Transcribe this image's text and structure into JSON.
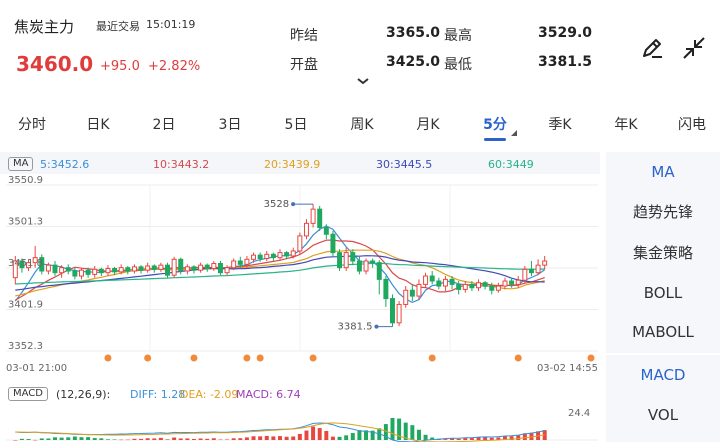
{
  "header": {
    "name": "焦炭主力",
    "recent_label": "最近交易",
    "time": "15:01:19",
    "price": "3460.0",
    "change": "+95.0",
    "change_pct": "+2.82%",
    "stats": [
      {
        "label": "昨结",
        "value": "3365.0"
      },
      {
        "label": "最高",
        "value": "3529.0"
      },
      {
        "label": "开盘",
        "value": "3425.0"
      },
      {
        "label": "最低",
        "value": "3381.5"
      }
    ]
  },
  "tabs": [
    "分时",
    "日K",
    "2日",
    "3日",
    "5日",
    "周K",
    "月K",
    "5分",
    "季K",
    "年K",
    "闪电"
  ],
  "active_tab": "5分",
  "ma": {
    "tag": "MA",
    "values": [
      {
        "text": "5:3452.6",
        "color": "#3a8fd8"
      },
      {
        "text": "10:3443.2",
        "color": "#d84a4a"
      },
      {
        "text": "20:3439.9",
        "color": "#e0a020"
      },
      {
        "text": "30:3445.5",
        "color": "#3f49b8"
      },
      {
        "text": "60:3449",
        "color": "#28b38a"
      }
    ]
  },
  "side_menu": {
    "items": [
      "MA",
      "趋势先锋",
      "集金策略",
      "BOLL",
      "MABOLL"
    ],
    "items2": [
      "MACD",
      "VOL"
    ]
  },
  "macd": {
    "tag": "MACD",
    "params": "(12,26,9):",
    "diff": "DIFF: 1.28",
    "dea": "DEA: -2.09",
    "macd": "MACD: 6.74",
    "scale_max": "24.4"
  },
  "chart_data": {
    "type": "candlestick",
    "y_labels": [
      "3550.9",
      "3501.3",
      "3451.8",
      "3401.9",
      "3352.3"
    ],
    "ylim": [
      3352.3,
      3550.9
    ],
    "high_label": "3528",
    "low_label": "3381.5",
    "x_start": "03-01 21:00",
    "x_end": "03-02 14:55",
    "candles": [
      [
        3440,
        3460,
        3432,
        3466
      ],
      [
        3460,
        3452,
        3446,
        3463
      ],
      [
        3452,
        3458,
        3448,
        3462
      ],
      [
        3458,
        3464,
        3452,
        3478
      ],
      [
        3464,
        3448,
        3444,
        3468
      ],
      [
        3448,
        3455,
        3444,
        3458
      ],
      [
        3455,
        3446,
        3442,
        3460
      ],
      [
        3446,
        3452,
        3440,
        3455
      ],
      [
        3452,
        3448,
        3444,
        3456
      ],
      [
        3448,
        3442,
        3438,
        3452
      ],
      [
        3442,
        3449,
        3438,
        3452
      ],
      [
        3449,
        3444,
        3440,
        3452
      ],
      [
        3444,
        3450,
        3440,
        3454
      ],
      [
        3450,
        3446,
        3442,
        3452
      ],
      [
        3446,
        3451,
        3442,
        3455
      ],
      [
        3451,
        3447,
        3443,
        3453
      ],
      [
        3447,
        3452,
        3444,
        3456
      ],
      [
        3452,
        3448,
        3444,
        3454
      ],
      [
        3448,
        3453,
        3445,
        3456
      ],
      [
        3453,
        3449,
        3445,
        3455
      ],
      [
        3449,
        3454,
        3446,
        3458
      ],
      [
        3454,
        3450,
        3446,
        3456
      ],
      [
        3450,
        3455,
        3447,
        3458
      ],
      [
        3455,
        3443,
        3440,
        3458
      ],
      [
        3443,
        3462,
        3440,
        3465
      ],
      [
        3462,
        3448,
        3444,
        3464
      ],
      [
        3448,
        3453,
        3444,
        3456
      ],
      [
        3453,
        3449,
        3445,
        3455
      ],
      [
        3449,
        3455,
        3446,
        3458
      ],
      [
        3455,
        3451,
        3447,
        3457
      ],
      [
        3451,
        3457,
        3448,
        3460
      ],
      [
        3457,
        3446,
        3443,
        3460
      ],
      [
        3446,
        3452,
        3443,
        3455
      ],
      [
        3452,
        3460,
        3449,
        3463
      ],
      [
        3460,
        3456,
        3452,
        3465
      ],
      [
        3456,
        3462,
        3452,
        3466
      ],
      [
        3462,
        3467,
        3458,
        3470
      ],
      [
        3467,
        3463,
        3459,
        3470
      ],
      [
        3463,
        3468,
        3460,
        3472
      ],
      [
        3468,
        3464,
        3460,
        3470
      ],
      [
        3464,
        3470,
        3461,
        3474
      ],
      [
        3470,
        3466,
        3462,
        3472
      ],
      [
        3466,
        3472,
        3463,
        3476
      ],
      [
        3472,
        3490,
        3468,
        3494
      ],
      [
        3490,
        3505,
        3486,
        3510
      ],
      [
        3505,
        3522,
        3500,
        3528
      ],
      [
        3522,
        3500,
        3496,
        3526
      ],
      [
        3500,
        3492,
        3486,
        3504
      ],
      [
        3492,
        3470,
        3466,
        3496
      ],
      [
        3470,
        3452,
        3448,
        3474
      ],
      [
        3452,
        3470,
        3448,
        3476
      ],
      [
        3470,
        3460,
        3455,
        3474
      ],
      [
        3460,
        3448,
        3444,
        3465
      ],
      [
        3448,
        3460,
        3444,
        3463
      ],
      [
        3460,
        3458,
        3452,
        3463
      ],
      [
        3458,
        3438,
        3420,
        3461
      ],
      [
        3438,
        3415,
        3405,
        3442
      ],
      [
        3415,
        3386,
        3381.5,
        3420
      ],
      [
        3386,
        3408,
        3382,
        3412
      ],
      [
        3408,
        3425,
        3404,
        3430
      ],
      [
        3425,
        3418,
        3412,
        3432
      ],
      [
        3418,
        3432,
        3414,
        3438
      ],
      [
        3432,
        3442,
        3428,
        3446
      ],
      [
        3442,
        3436,
        3432,
        3448
      ],
      [
        3436,
        3430,
        3426,
        3440
      ],
      [
        3430,
        3438,
        3424,
        3442
      ],
      [
        3438,
        3432,
        3426,
        3442
      ],
      [
        3432,
        3426,
        3420,
        3436
      ],
      [
        3426,
        3432,
        3422,
        3436
      ],
      [
        3432,
        3428,
        3424,
        3436
      ],
      [
        3428,
        3434,
        3424,
        3438
      ],
      [
        3434,
        3430,
        3426,
        3436
      ],
      [
        3430,
        3425,
        3420,
        3434
      ],
      [
        3425,
        3430,
        3422,
        3434
      ],
      [
        3430,
        3436,
        3426,
        3440
      ],
      [
        3436,
        3432,
        3428,
        3440
      ],
      [
        3432,
        3437,
        3428,
        3442
      ],
      [
        3437,
        3450,
        3434,
        3454
      ],
      [
        3450,
        3446,
        3442,
        3460
      ],
      [
        3446,
        3455,
        3443,
        3462
      ],
      [
        3455,
        3460,
        3450,
        3466
      ]
    ],
    "event_markers": [
      14,
      20,
      27,
      35,
      37,
      45,
      63,
      76,
      87
    ]
  }
}
